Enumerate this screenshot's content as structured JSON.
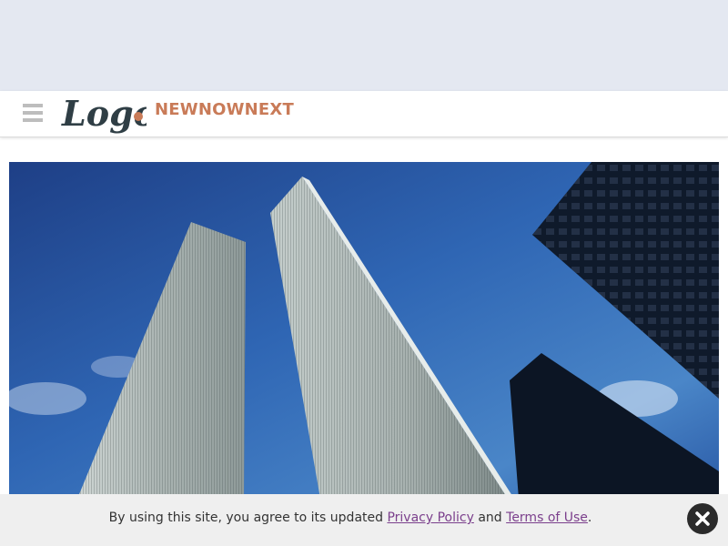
{
  "header": {
    "logo_text": "Logo",
    "brand_name": "NEWNOWNEXT"
  },
  "hero": {
    "image_subject": "twin-towers-skyline"
  },
  "consent": {
    "text_before": "By using this site, you agree to its updated ",
    "privacy_label": "Privacy Policy",
    "text_middle": " and ",
    "terms_label": "Terms of Use",
    "text_after": "."
  },
  "icons": {
    "menu": "hamburger-menu-icon",
    "close": "close-icon"
  },
  "colors": {
    "brand": "#c97b58",
    "logo": "#2f3e45",
    "link": "#7b3f8c",
    "ad_background": "#e4e8f1"
  }
}
